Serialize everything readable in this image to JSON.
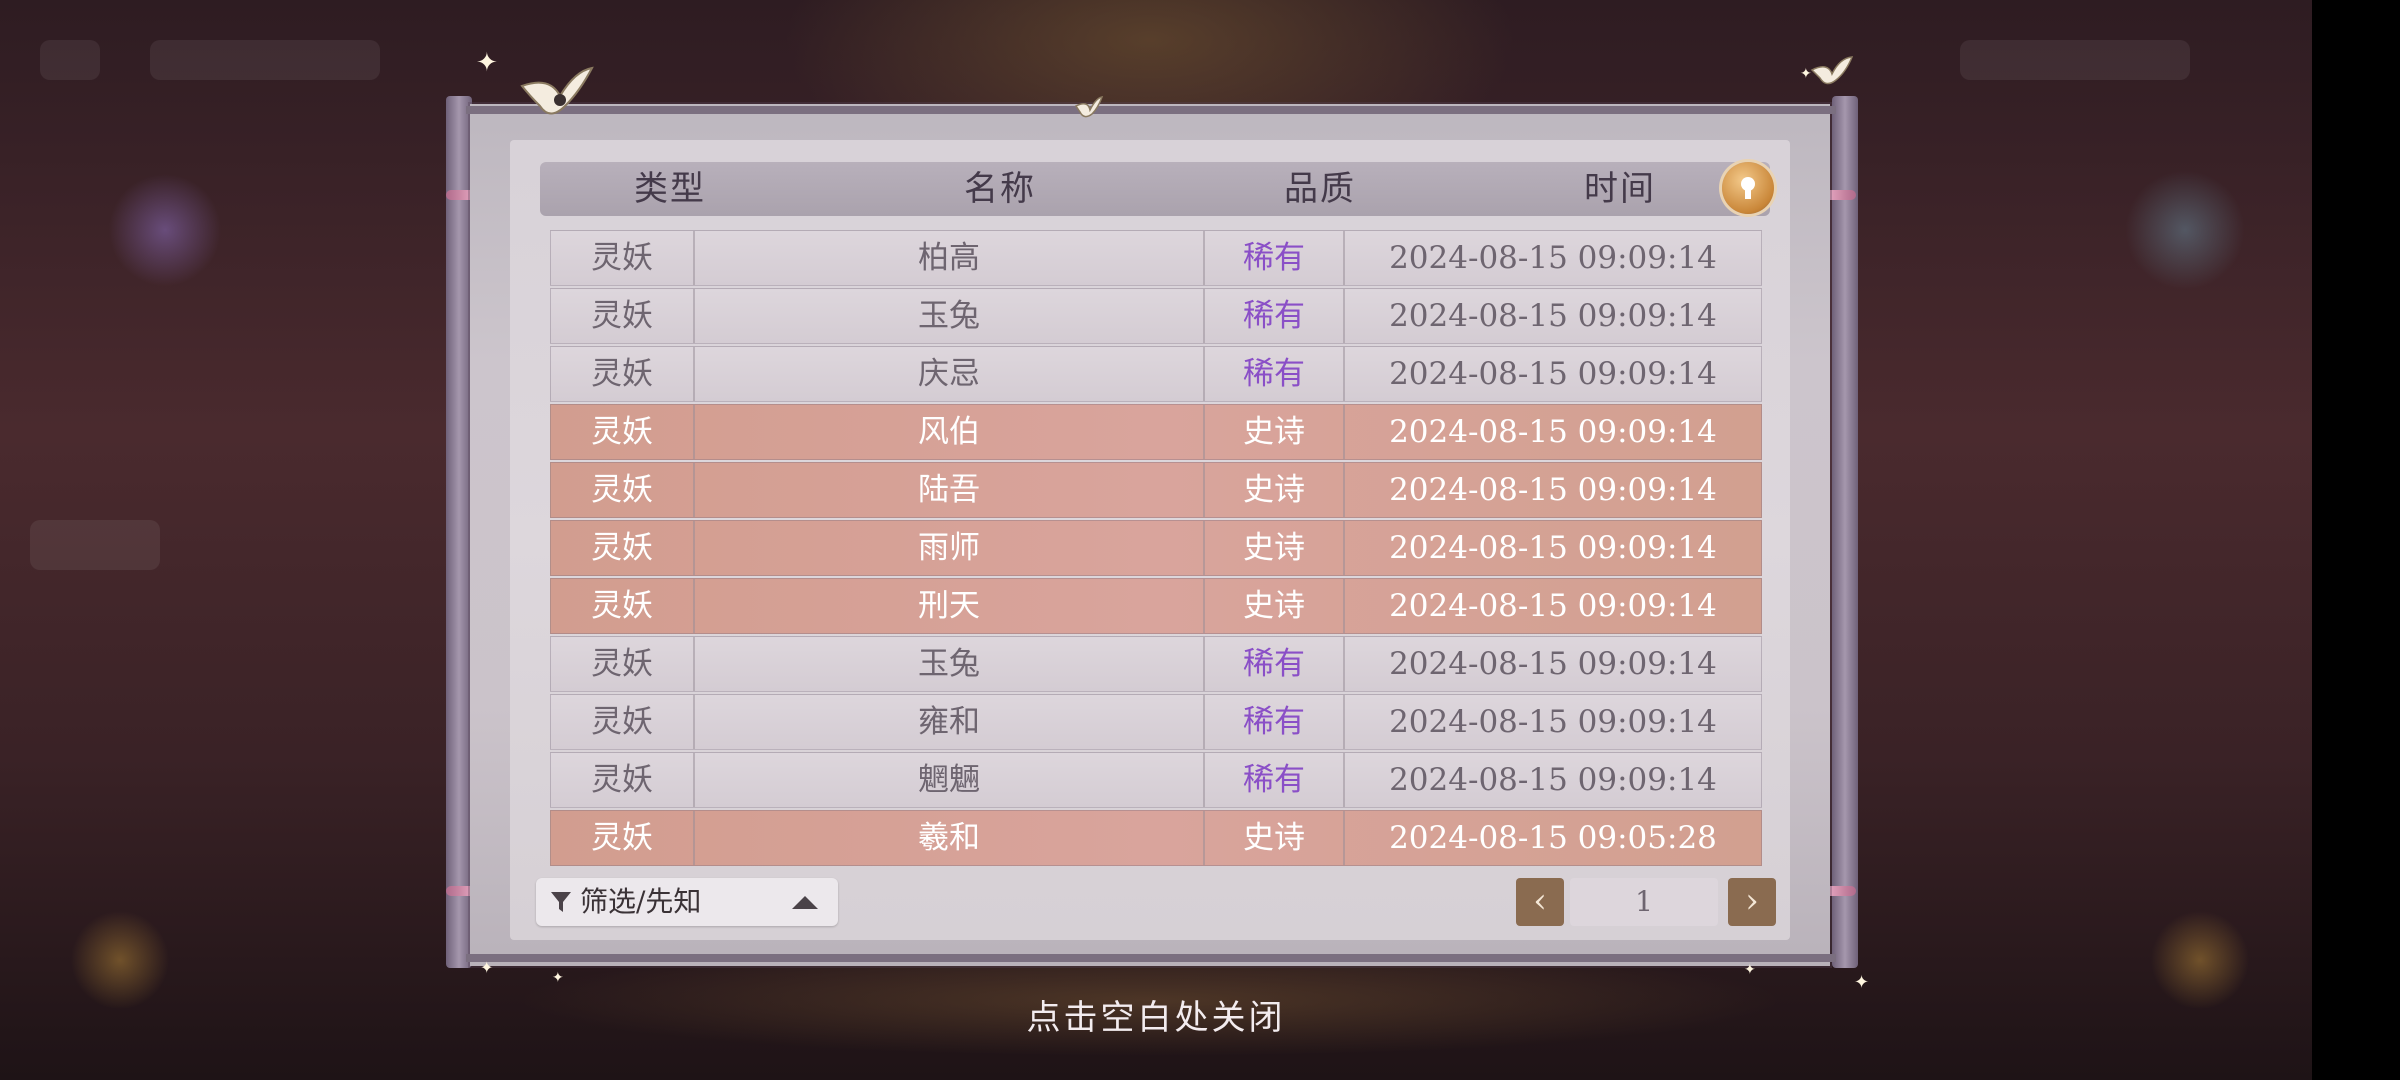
{
  "table": {
    "headers": [
      "类型",
      "名称",
      "品质",
      "时间"
    ],
    "rows": [
      {
        "type": "灵妖",
        "name": "柏高",
        "quality": "稀有",
        "time": "2024-08-15  09:09:14",
        "tier": "rare"
      },
      {
        "type": "灵妖",
        "name": "玉兔",
        "quality": "稀有",
        "time": "2024-08-15  09:09:14",
        "tier": "rare"
      },
      {
        "type": "灵妖",
        "name": "庆忌",
        "quality": "稀有",
        "time": "2024-08-15  09:09:14",
        "tier": "rare"
      },
      {
        "type": "灵妖",
        "name": "风伯",
        "quality": "史诗",
        "time": "2024-08-15  09:09:14",
        "tier": "epic"
      },
      {
        "type": "灵妖",
        "name": "陆吾",
        "quality": "史诗",
        "time": "2024-08-15  09:09:14",
        "tier": "epic"
      },
      {
        "type": "灵妖",
        "name": "雨师",
        "quality": "史诗",
        "time": "2024-08-15  09:09:14",
        "tier": "epic"
      },
      {
        "type": "灵妖",
        "name": "刑天",
        "quality": "史诗",
        "time": "2024-08-15  09:09:14",
        "tier": "epic"
      },
      {
        "type": "灵妖",
        "name": "玉兔",
        "quality": "稀有",
        "time": "2024-08-15  09:09:14",
        "tier": "rare"
      },
      {
        "type": "灵妖",
        "name": "雍和",
        "quality": "稀有",
        "time": "2024-08-15  09:09:14",
        "tier": "rare"
      },
      {
        "type": "灵妖",
        "name": "魍魎",
        "quality": "稀有",
        "time": "2024-08-15  09:09:14",
        "tier": "rare"
      },
      {
        "type": "灵妖",
        "name": "羲和",
        "quality": "史诗",
        "time": "2024-08-15  09:05:28",
        "tier": "epic"
      }
    ]
  },
  "info_icon": "lightbulb-icon",
  "filter": {
    "label": "筛选/先知",
    "icon": "filter-icon"
  },
  "pagination": {
    "prev": "‹",
    "page": "1",
    "next": "›"
  },
  "close_hint": "点击空白处关闭",
  "colors": {
    "rare_text": "#8a4fc7",
    "epic_row": "#d29d8f",
    "page_button": "#8a6b50"
  }
}
